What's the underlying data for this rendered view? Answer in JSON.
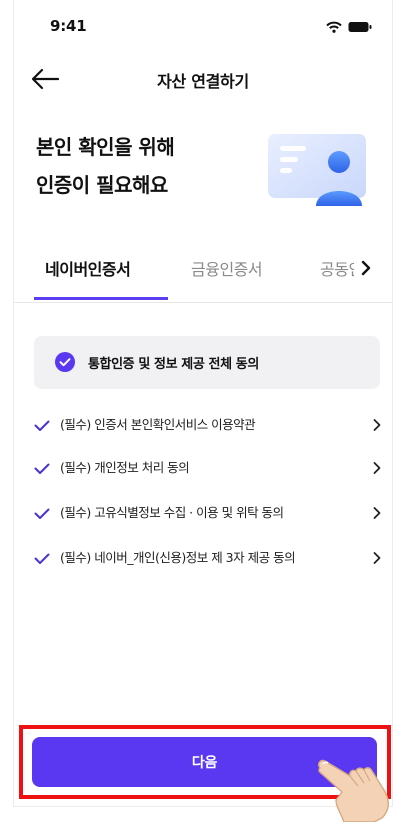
{
  "status_bar": {
    "time": "9:41"
  },
  "header": {
    "title": "자산 연결하기"
  },
  "headline": {
    "line1": "본인 확인을 위해",
    "line2": "인증이 필요해요"
  },
  "tabs": [
    {
      "label": "네이버인증서",
      "active": true
    },
    {
      "label": "금융인증서",
      "active": false
    },
    {
      "label": "공동인증서",
      "active": false
    }
  ],
  "agree_all": {
    "label": "통합인증 및 정보 제공 전체 동의",
    "checked": true
  },
  "terms": [
    {
      "label": "(필수) 인증서 본인확인서비스 이용약관",
      "checked": true
    },
    {
      "label": "(필수) 개인정보 처리 동의",
      "checked": true
    },
    {
      "label": "(필수) 고유식별정보 수집 · 이용 및 위탁 동의",
      "checked": true
    },
    {
      "label": "(필수) 네이버_개인(신용)정보 제 3자 제공 동의",
      "checked": true
    }
  ],
  "next_button": {
    "label": "다음"
  },
  "colors": {
    "accent": "#5a37f0",
    "highlight_frame": "#ee1111",
    "panel": "#f1f1f3"
  }
}
